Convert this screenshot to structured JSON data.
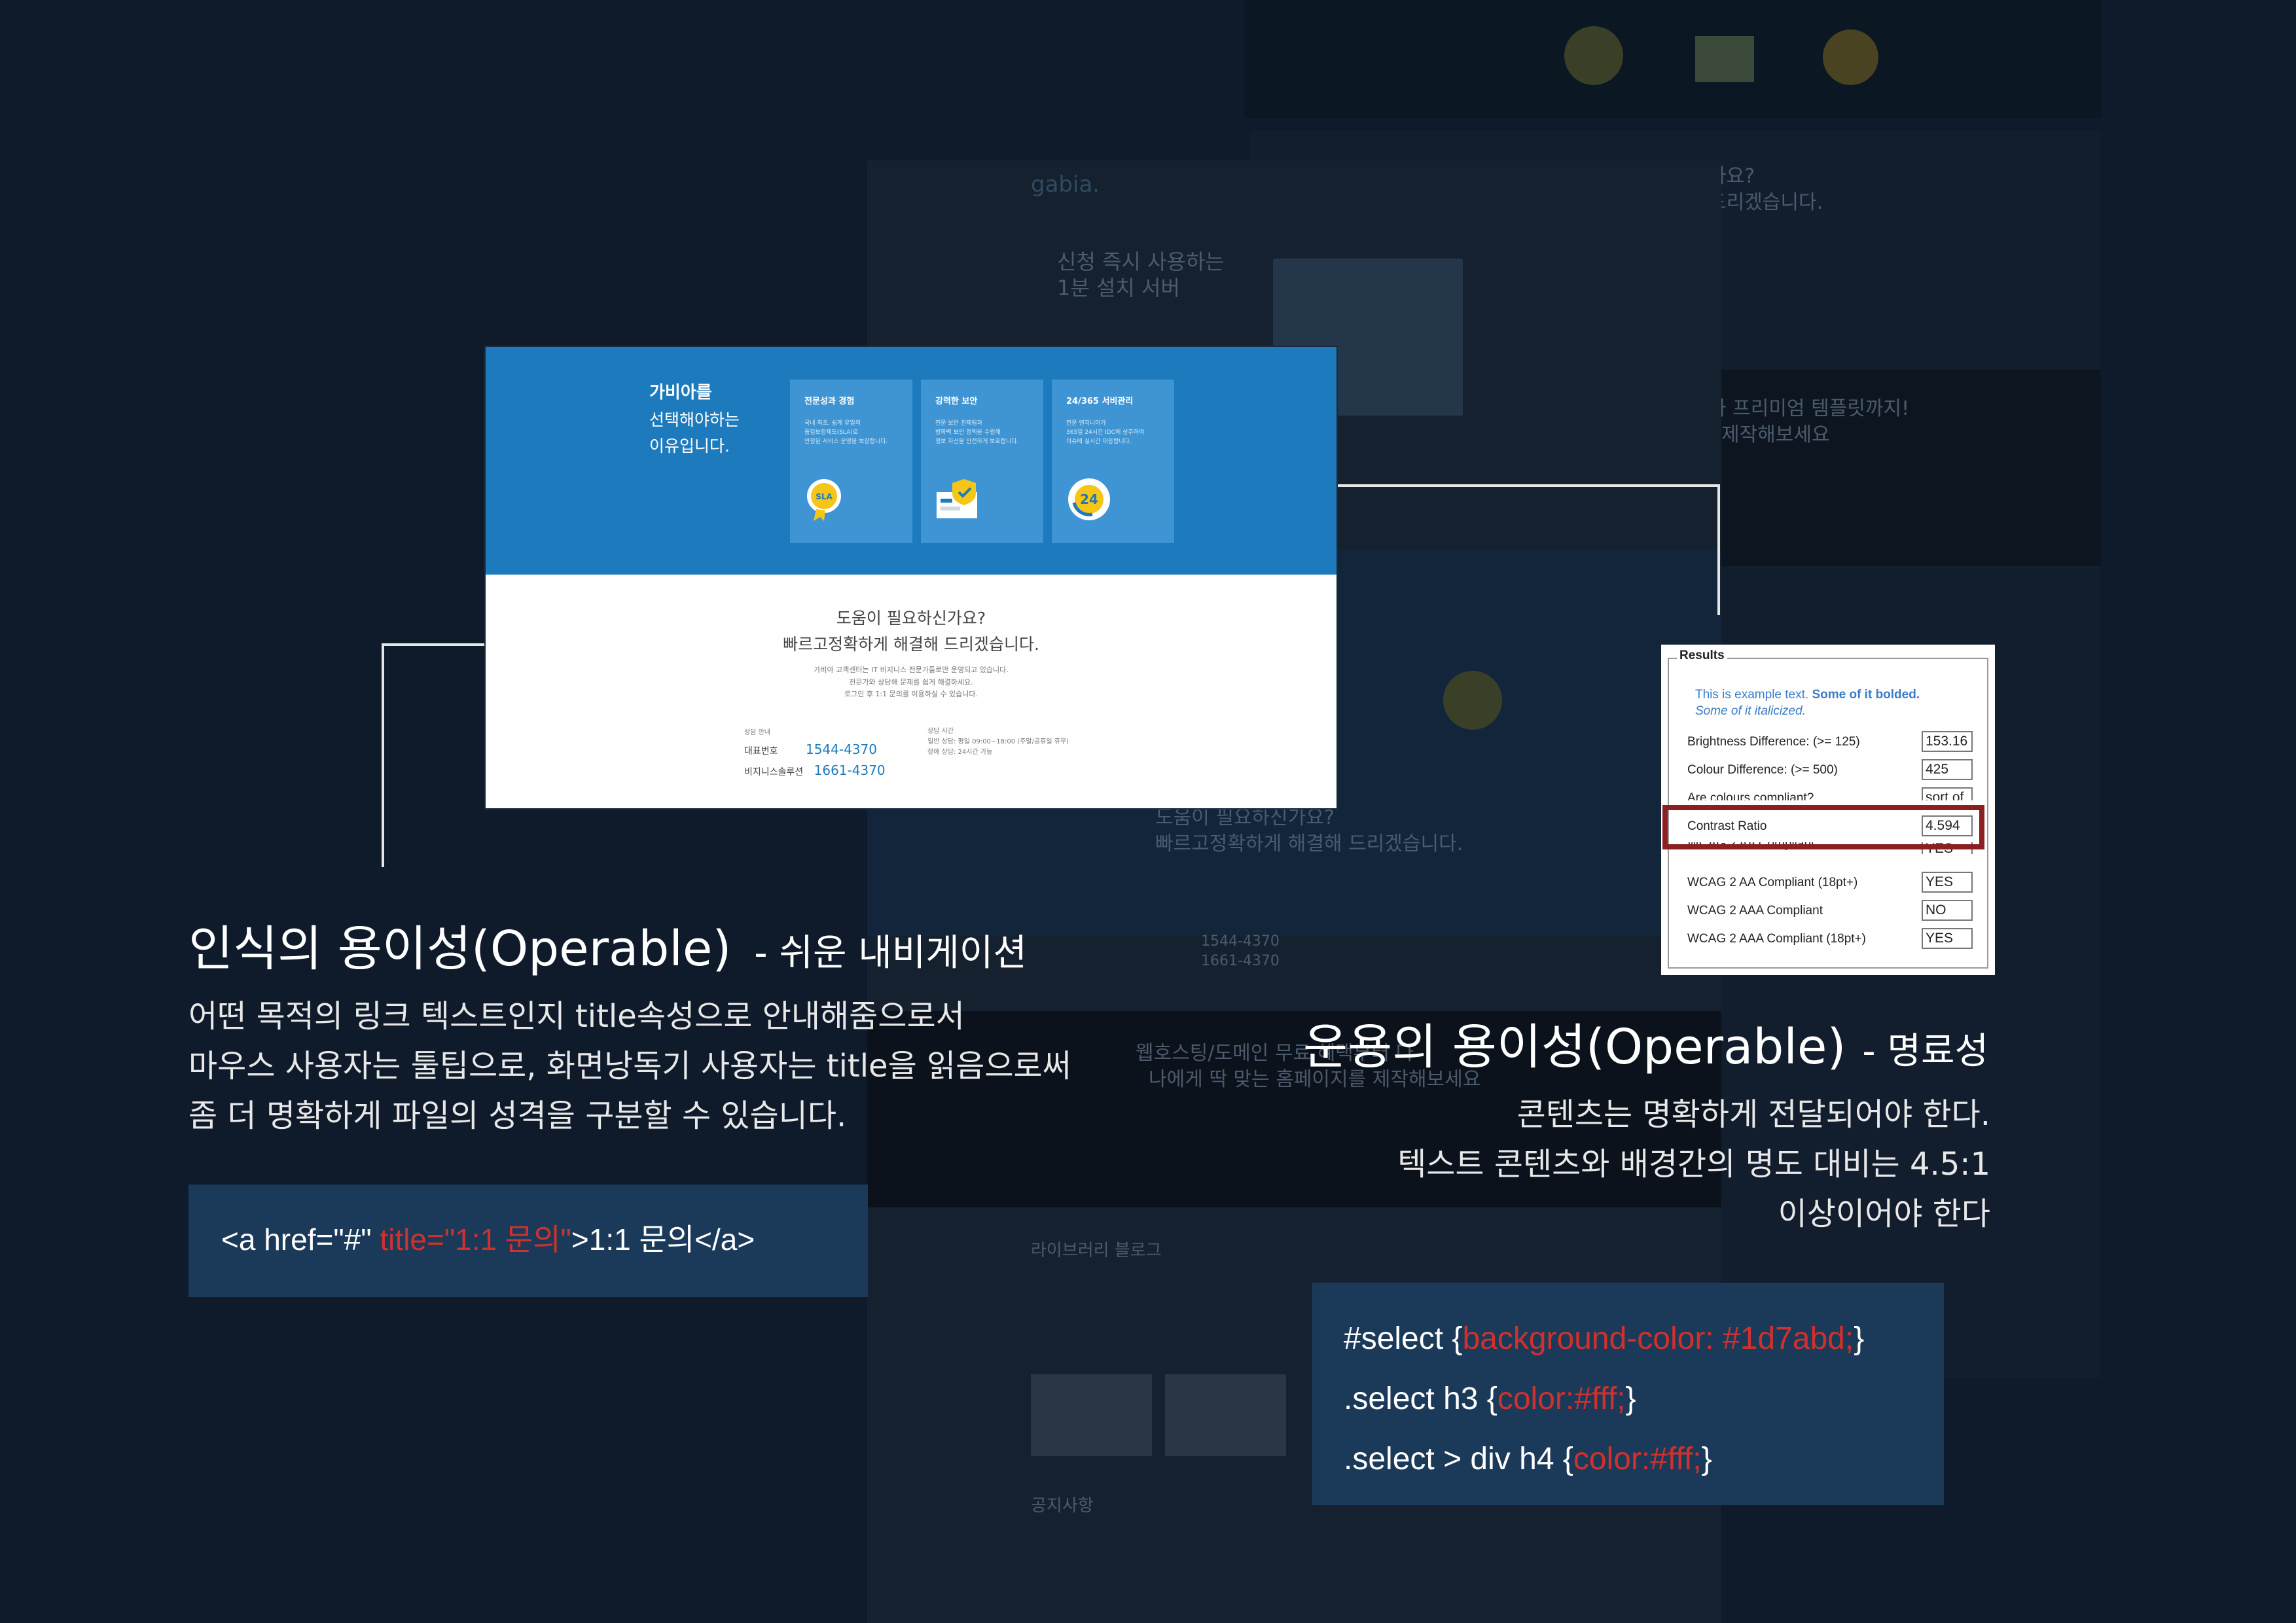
{
  "colors": {
    "brand_blue": "#1d7abd",
    "panel_blue": "#3f95d3",
    "code_red": "#d0312d",
    "highlight": "#8c1f22",
    "code_bg": "#1b3a59"
  },
  "background_screens": {
    "logo": "gabia.",
    "hero_line1": "신청 즉시 사용하는",
    "hero_line2": "1분 설치 서버",
    "help_line1": "도움이 필요하신가요?",
    "help_line2": "빠르고정확하게 해결해 드리겠습니다.",
    "phone1": "1544-4370",
    "phone2": "1661-4370",
    "banner_line1": "웹호스팅/도메인 무료 혜택부터 다",
    "banner_line2": "나에게 딱 맞는 홈페이지를 제작해보세요",
    "blog_title": "라이브러리 블로그",
    "notice_title": "공지사항",
    "right_q": "사요?",
    "right_q2": "드리겠습니다.",
    "right_premium": "와 프리미엄 템플릿까지!",
    "right_premium2": "제작해보세요"
  },
  "main_card": {
    "why_bold": "가비아를",
    "why_line2": "선택해야하는",
    "why_line3": "이유입니다.",
    "features": [
      {
        "title": "전문성과 경험",
        "desc1": "국내 최초, 쉽게 유일의",
        "desc2": "품질보장제도(SLA)로",
        "desc3": "안정된 서비스 운영을 보장합니다.",
        "icon": "sla-badge-icon",
        "icon_text": "SLA"
      },
      {
        "title": "강력한 보안",
        "desc1": "전문 보안 관제팀과",
        "desc2": "방화벽 보안 정책을 수립해",
        "desc3": "정보 자산을 안전하게 보호합니다.",
        "icon": "security-shield-icon",
        "icon_text": ""
      },
      {
        "title": "24/365 서비관리",
        "desc1": "전문 엔지니어가",
        "desc2": "365일 24시간 IDC에 상주하여",
        "desc3": "이슈에 실시간 대응합니다.",
        "icon": "24h-service-icon",
        "icon_text": "24"
      }
    ],
    "help_title1": "도움이 필요하신가요?",
    "help_title2": "빠르고정확하게 해결해 드리겠습니다.",
    "help_sub1": "가비아 고객센터는 IT 비지니스 전문가들로만 운영되고 있습니다.",
    "help_sub2": "전문가와 상담해 문제를 쉽게 해결하세요.",
    "help_sub3": "로그인 후 1:1 문의를 이용하실 수 있습니다.",
    "contact_label": "상담 안내",
    "main_phone_label": "대표번호",
    "main_phone": "1544-4370",
    "biz_phone_label": "비지니스솔루션",
    "biz_phone": "1661-4370",
    "hours_label": "상담 시간",
    "hours_line1": "일반 상담: 평일 09:00~18:00 (주말/공휴일 휴무)",
    "hours_line2": "장애 상담: 24시간 가능"
  },
  "checker": {
    "legend": "Results",
    "sample_text": "This is example text.",
    "sample_bold": "Some of it bolded.",
    "sample_italic": "Some of it italicized.",
    "rows": [
      {
        "label": "Brightness Difference: (>= 125)",
        "value": "153.16"
      },
      {
        "label": "Colour Difference: (>= 500)",
        "value": "425"
      },
      {
        "label": "Are colours compliant?",
        "value": "sort of"
      },
      {
        "label": "Contrast Ratio",
        "value": "4.594"
      },
      {
        "label": "WCAG 2 AA Compliant",
        "value": "YES"
      },
      {
        "label": "WCAG 2 AA Compliant (18pt+)",
        "value": "YES"
      },
      {
        "label": "WCAG 2 AAA Compliant",
        "value": "NO"
      },
      {
        "label": "WCAG 2 AAA Compliant (18pt+)",
        "value": "YES"
      }
    ]
  },
  "left_section": {
    "heading_big": "인식의 용이성(Operable)",
    "heading_small": "- 쉬운 내비게이션",
    "body1": "어떤 목적의 링크 텍스트인지 title속성으로 안내해줌으로서",
    "body2": "마우스 사용자는 툴팁으로, 화면낭독기 사용자는 title을 읽음으로써",
    "body3": "좀 더 명확하게 파일의 성격을 구분할 수 있습니다.",
    "code_pre": "<a href=\"#\" ",
    "code_attr": "title=\"1:1 문의\"",
    "code_post": ">1:1 문의</a>"
  },
  "right_section": {
    "heading_big": "운용의 용이성(Operable)",
    "heading_small": "- 명료성",
    "body1": "콘텐츠는 명확하게 전달되어야 한다.",
    "body2": "텍스트 콘텐츠와 배경간의 명도 대비는 4.5:1",
    "body3": "이상이어야 한다",
    "code1_pre": "#select {",
    "code1_val": "background-color: #1d7abd;",
    "code1_post": "}",
    "code2_pre": ".select h3 {",
    "code2_val": "color:#fff;",
    "code2_post": "}",
    "code3_pre": ".select > div h4 {",
    "code3_val": "color:#fff;",
    "code3_post": "}"
  }
}
